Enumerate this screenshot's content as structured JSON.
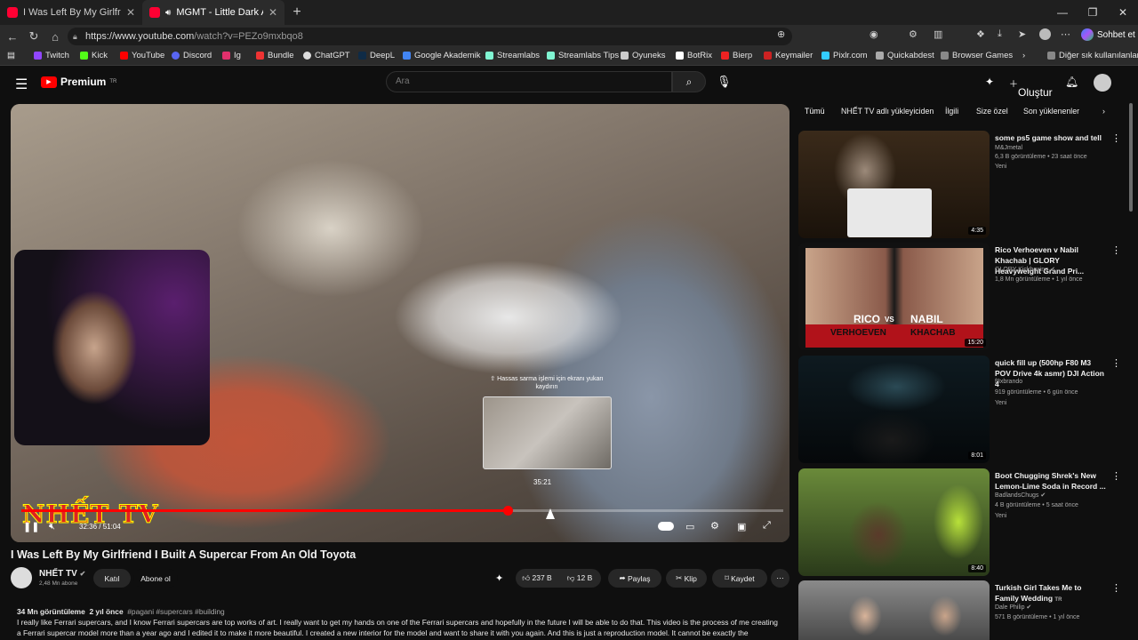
{
  "browser": {
    "tabs": [
      {
        "title": "I Was Left By My Girlfriend I Built A",
        "active": false
      },
      {
        "title": "MGMT - Little Dark Age (Offic",
        "active": true
      }
    ],
    "url_host": "https://www.youtube.com",
    "url_path": "/watch?v=PEZo9mxbqo8",
    "chat_label": "Sohbet et",
    "bookmarks": [
      "Twitch",
      "Kick",
      "YouTube",
      "Discord",
      "Ig",
      "Bundle",
      "ChatGPT",
      "DeepL",
      "Google Akademik",
      "Streamlabs",
      "Streamlabs Tips",
      "Oyuneks",
      "BotRix",
      "Bierp",
      "Keymailer",
      "Pixlr.com",
      "Quickabdest",
      "Browser Games"
    ],
    "bookmarks_more": "Diğer sık kullanılanlar"
  },
  "youtube": {
    "logo": "Premium",
    "logo_region": "TR",
    "search_placeholder": "Ara",
    "create_label": "Oluştur"
  },
  "player": {
    "hover_hint": "⇧ Hassas sarma işlemi için ekranı yukarı kaydırın",
    "preview_time": "35:21",
    "watermark": "NHẾT TV",
    "current_time": "32:36",
    "total_time": "51:04",
    "progress": 0.638,
    "preview_progress": 0.692
  },
  "video": {
    "title": "I Was Left By My Girlfriend I Built A Supercar From An Old Toyota",
    "channel": "NHẾT TV",
    "subscribers": "2,48 Mn abone",
    "join_label": "Katıl",
    "subscribe_label": "Abone ol",
    "likes": "237 B",
    "dislikes": "12 B",
    "share_label": "Paylaş",
    "clip_label": "Klip",
    "save_label": "Kaydet",
    "views": "34 Mn görüntüleme",
    "age": "2 yıl önce",
    "tags": "#pagani #supercars #building",
    "description_line1": "I really like Ferrari supercars, and I know Ferrari supercars are top works of art.  I really want to get my hands on one of the Ferrari supercars and hopefully in the future I will be able to do that.  This video is the process of me creating",
    "description_line2": "a Ferrari supercar model more than a year ago and I edited it to make it more beautiful. I created a new interior for the model and want to share it with you again.    And this is just a reproduction model. It cannot be exactly the"
  },
  "chips": [
    "Tümü",
    "NHẾT TV adlı yükleyiciden",
    "İlgili",
    "Size özel",
    "Son yüklenenler"
  ],
  "recommendations": [
    {
      "title": "some ps5 game show and tell",
      "channel": "M&Jmetal",
      "meta": "6,3 B görüntüleme • 23 saat önce",
      "new": "Yeni",
      "duration": "4:35",
      "verified": false
    },
    {
      "title": "Rico Verhoeven v Nabil Khachab | GLORY Heavyweight Grand Pri...",
      "channel": "GLORY Kickboxing",
      "meta": "1,8 Mn görüntüleme • 1 yıl önce",
      "new": "",
      "duration": "15:20",
      "verified": true
    },
    {
      "title": "quick fill up (500hp F80 M3 POV Drive 4k asmr) DJI Action 4",
      "channel": "f8xbrando",
      "meta": "919 görüntüleme • 6 gün önce",
      "new": "Yeni",
      "duration": "8:01",
      "verified": false
    },
    {
      "title": "Boot Chugging Shrek's New Lemon-Lime Soda in Record ...",
      "channel": "BadlandsChugs",
      "meta": "4 B görüntüleme • 5 saat önce",
      "new": "Yeni",
      "duration": "8:40",
      "verified": true
    },
    {
      "title": "Turkish Girl Takes Me to Family Wedding",
      "channel": "Dale Philip",
      "meta": "571 B görüntüleme • 1 yıl önce",
      "new": "",
      "duration": "",
      "verified": true,
      "title_badge": "TR"
    }
  ],
  "thumb_text": {
    "rico": "RICO",
    "vs": "VS",
    "nabil": "NABIL",
    "verhoeven": "VERHOEVEN",
    "khachab": "KHACHAB"
  },
  "colors": {
    "accent": "#ff0000",
    "background": "#0f0f0f"
  }
}
